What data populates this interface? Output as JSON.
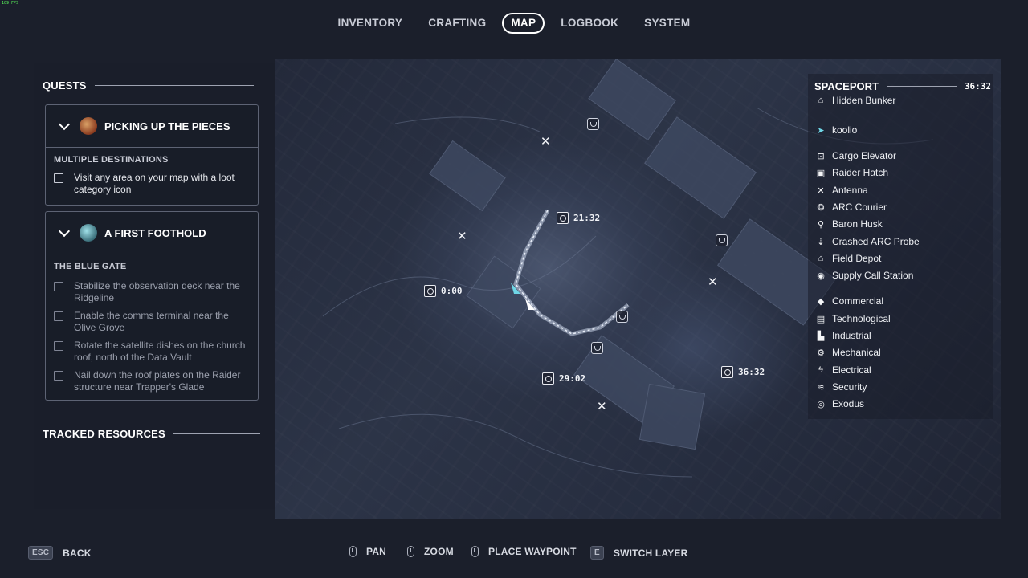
{
  "fps": "109 FPS",
  "nav": {
    "tabs": [
      {
        "label": "INVENTORY",
        "active": false
      },
      {
        "label": "CRAFTING",
        "active": false
      },
      {
        "label": "MAP",
        "active": true
      },
      {
        "label": "LOGBOOK",
        "active": false
      },
      {
        "label": "SYSTEM",
        "active": false
      }
    ]
  },
  "quests": {
    "heading": "QUESTS",
    "cards": [
      {
        "title": "PICKING UP THE PIECES",
        "icon": "quest-giver-portrait-icon",
        "subheading": "MULTIPLE DESTINATIONS",
        "objectives": [
          "Visit any area on your map with a loot category icon"
        ]
      },
      {
        "title": "A FIRST FOOTHOLD",
        "icon": "quest-giver-portrait-icon",
        "subheading": "THE BLUE GATE",
        "objectives": [
          "Stabilize the observation deck near the Ridgeline",
          "Enable the comms terminal near the Olive Grove",
          "Rotate the satellite dishes on the church roof, north of the Data Vault",
          "Nail down the roof plates on the Raider structure near Trapper's Glade"
        ]
      }
    ]
  },
  "tracked_resources": {
    "heading": "TRACKED RESOURCES"
  },
  "map": {
    "timers": [
      "21:32",
      "0:00",
      "29:02",
      "36:32"
    ]
  },
  "legend": {
    "area": "SPACEPORT",
    "time": "36:32",
    "items": [
      {
        "label": "Hidden Bunker",
        "icon": "bunker-icon"
      },
      {
        "label": "koolio",
        "icon": "player-cursor-icon"
      },
      {
        "label": "Cargo Elevator",
        "icon": "cargo-elevator-icon"
      },
      {
        "label": "Raider Hatch",
        "icon": "raider-hatch-icon"
      },
      {
        "label": "Antenna",
        "icon": "antenna-icon"
      },
      {
        "label": "ARC Courier",
        "icon": "arc-courier-icon"
      },
      {
        "label": "Baron Husk",
        "icon": "baron-husk-icon"
      },
      {
        "label": "Crashed ARC Probe",
        "icon": "crashed-probe-icon"
      },
      {
        "label": "Field Depot",
        "icon": "field-depot-icon"
      },
      {
        "label": "Supply Call Station",
        "icon": "supply-station-icon"
      },
      {
        "label": "Commercial",
        "icon": "commercial-icon"
      },
      {
        "label": "Technological",
        "icon": "technological-icon"
      },
      {
        "label": "Industrial",
        "icon": "industrial-icon"
      },
      {
        "label": "Mechanical",
        "icon": "mechanical-icon"
      },
      {
        "label": "Electrical",
        "icon": "electrical-icon"
      },
      {
        "label": "Security",
        "icon": "security-icon"
      },
      {
        "label": "Exodus",
        "icon": "exodus-icon"
      }
    ]
  },
  "hints": {
    "back_key": "ESC",
    "back": "BACK",
    "pan": "PAN",
    "zoom": "ZOOM",
    "waypoint": "PLACE WAYPOINT",
    "layer_key": "E",
    "layer": "SWITCH LAYER"
  }
}
